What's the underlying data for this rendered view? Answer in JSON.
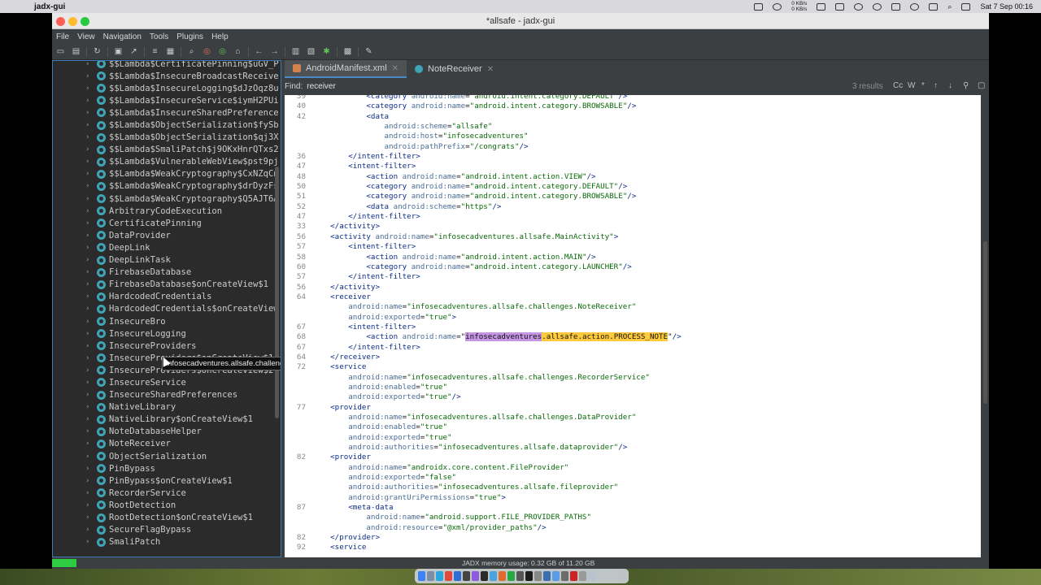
{
  "menubar": {
    "app_name": "jadx-gui",
    "kb_up": "0 KB/s",
    "kb_down": "0 KB/s",
    "datetime": "Sat 7 Sep  00:16"
  },
  "window": {
    "title": "*allsafe - jadx-gui"
  },
  "menu": [
    "File",
    "View",
    "Navigation",
    "Tools",
    "Plugins",
    "Help"
  ],
  "tree": {
    "items": [
      "$$Lambda$CertificatePinning$uGV_P",
      "$$Lambda$InsecureBroadcastReceive",
      "$$Lambda$InsecureLogging$dJzOqz8u",
      "$$Lambda$InsecureService$iymH2PUi",
      "$$Lambda$InsecureSharedPreference",
      "$$Lambda$ObjectSerialization$fySb",
      "$$Lambda$ObjectSerialization$qj3X",
      "$$Lambda$SmaliPatch$j9OKxHnrQTxs2",
      "$$Lambda$VulnerableWebView$pst9pj",
      "$$Lambda$WeakCryptography$CxNZqCn",
      "$$Lambda$WeakCryptography$drDyzFs",
      "$$Lambda$WeakCryptography$Q5AJT6A",
      "ArbitraryCodeExecution",
      "CertificatePinning",
      "DataProvider",
      "DeepLink",
      "DeepLinkTask",
      "FirebaseDatabase",
      "FirebaseDatabase$onCreateView$1",
      "HardcodedCredentials",
      "HardcodedCredentials$onCreateView",
      "InsecureBro",
      "InsecureLogging",
      "InsecureProviders",
      "InsecureProviders$onCreateView$1",
      "InsecureProviders$onCreateView$2",
      "InsecureService",
      "InsecureSharedPreferences",
      "NativeLibrary",
      "NativeLibrary$onCreateView$1",
      "NoteDatabaseHelper",
      "NoteReceiver",
      "ObjectSerialization",
      "PinBypass",
      "PinBypass$onCreateView$1",
      "RecorderService",
      "RootDetection",
      "RootDetection$onCreateView$1",
      "SecureFlagBypass",
      "SmaliPatch"
    ],
    "tooltip": "infosecadventures.allsafe.challenges.DeepLinkTask"
  },
  "tabs": [
    {
      "label": "AndroidManifest.xml",
      "active": true
    },
    {
      "label": "NoteReceiver",
      "active": false
    }
  ],
  "find": {
    "label": "Find:",
    "value": "receiver",
    "results": "3 results",
    "cc": "Cc",
    "w": "W",
    "star": "*"
  },
  "code": {
    "lines": [
      {
        "n": "39",
        "t": "            <category android:name=\"android.intent.category.DEFAULT\"/>"
      },
      {
        "n": "40",
        "t": "            <category android:name=\"android.intent.category.BROWSABLE\"/>"
      },
      {
        "n": "42",
        "t": "            <data"
      },
      {
        "n": "",
        "t": "                android:scheme=\"allsafe\""
      },
      {
        "n": "",
        "t": "                android:host=\"infosecadventures\""
      },
      {
        "n": "",
        "t": "                android:pathPrefix=\"/congrats\"/>"
      },
      {
        "n": "36",
        "t": "        </intent-filter>"
      },
      {
        "n": "47",
        "t": "        <intent-filter>"
      },
      {
        "n": "48",
        "t": "            <action android:name=\"android.intent.action.VIEW\"/>"
      },
      {
        "n": "50",
        "t": "            <category android:name=\"android.intent.category.DEFAULT\"/>"
      },
      {
        "n": "51",
        "t": "            <category android:name=\"android.intent.category.BROWSABLE\"/>"
      },
      {
        "n": "52",
        "t": "            <data android:scheme=\"https\"/>"
      },
      {
        "n": "47",
        "t": "        </intent-filter>"
      },
      {
        "n": "33",
        "t": "    </activity>"
      },
      {
        "n": "56",
        "t": "    <activity android:name=\"infosecadventures.allsafe.MainActivity\">"
      },
      {
        "n": "57",
        "t": "        <intent-filter>"
      },
      {
        "n": "58",
        "t": "            <action android:name=\"android.intent.action.MAIN\"/>"
      },
      {
        "n": "60",
        "t": "            <category android:name=\"android.intent.category.LAUNCHER\"/>"
      },
      {
        "n": "57",
        "t": "        </intent-filter>"
      },
      {
        "n": "56",
        "t": "    </activity>"
      },
      {
        "n": "64",
        "t": "    <receiver"
      },
      {
        "n": "",
        "t": "        android:name=\"infosecadventures.allsafe.challenges.NoteReceiver\""
      },
      {
        "n": "",
        "t": "        android:exported=\"true\">"
      },
      {
        "n": "67",
        "t": "        <intent-filter>"
      },
      {
        "n": "68",
        "t": "            <action android:name=\"",
        "hl1": "infosecadventures",
        "hl2": ".allsafe.action.PROCESS_NOTE",
        "tail": "\"/>"
      },
      {
        "n": "67",
        "t": "        </intent-filter>"
      },
      {
        "n": "64",
        "t": "    </receiver>"
      },
      {
        "n": "72",
        "t": "    <service"
      },
      {
        "n": "",
        "t": "        android:name=\"infosecadventures.allsafe.challenges.RecorderService\""
      },
      {
        "n": "",
        "t": "        android:enabled=\"true\""
      },
      {
        "n": "",
        "t": "        android:exported=\"true\"/>"
      },
      {
        "n": "77",
        "t": "    <provider"
      },
      {
        "n": "",
        "t": "        android:name=\"infosecadventures.allsafe.challenges.DataProvider\""
      },
      {
        "n": "",
        "t": "        android:enabled=\"true\""
      },
      {
        "n": "",
        "t": "        android:exported=\"true\""
      },
      {
        "n": "",
        "t": "        android:authorities=\"infosecadventures.allsafe.dataprovider\"/>"
      },
      {
        "n": "82",
        "t": "    <provider"
      },
      {
        "n": "",
        "t": "        android:name=\"androidx.core.content.FileProvider\""
      },
      {
        "n": "",
        "t": "        android:exported=\"false\""
      },
      {
        "n": "",
        "t": "        android:authorities=\"infosecadventures.allsafe.fileprovider\""
      },
      {
        "n": "",
        "t": "        android:grantUriPermissions=\"true\">"
      },
      {
        "n": "87",
        "t": "        <meta-data"
      },
      {
        "n": "",
        "t": "            android:name=\"android.support.FILE_PROVIDER_PATHS\""
      },
      {
        "n": "",
        "t": "            android:resource=\"@xml/provider_paths\"/>"
      },
      {
        "n": "82",
        "t": "    </provider>"
      },
      {
        "n": "92",
        "t": "    <service"
      }
    ]
  },
  "status": {
    "memory": "JADX memory usage: 0.32 GB of 11.20 GB"
  }
}
